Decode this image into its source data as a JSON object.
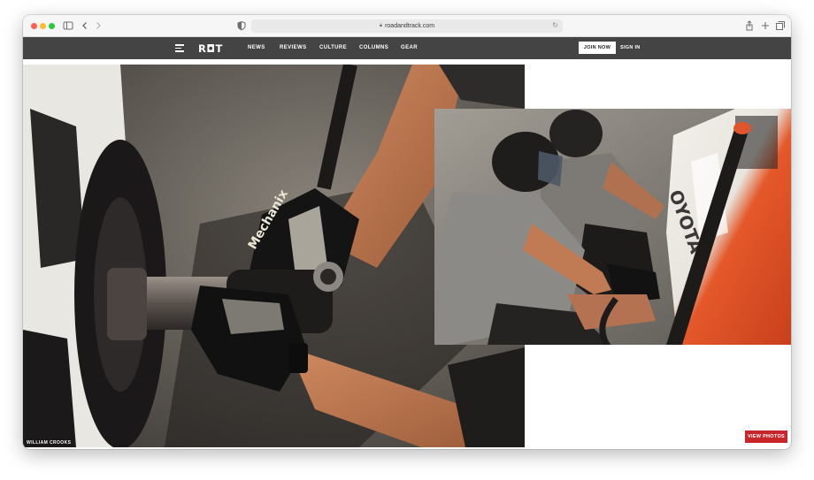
{
  "browser": {
    "url": "roadandtrack.com",
    "icons": [
      "sidebar-icon",
      "back-icon",
      "forward-icon",
      "privacy-icon",
      "lock-icon",
      "reload-icon",
      "share-icon",
      "new-tab-icon",
      "tabs-icon"
    ]
  },
  "site": {
    "logo_text": "R◘T",
    "nav": [
      "NEWS",
      "REVIEWS",
      "CULTURE",
      "COLUMNS",
      "GEAR"
    ],
    "join_label": "JOIN NOW",
    "signin_label": "SIGN IN"
  },
  "hero": {
    "photo_credit": "WILLIAM CROOKS",
    "view_photos_label": "VIEW PHOTOS",
    "glove_text": "Mechanix"
  },
  "colors": {
    "nav_bg": "#444444",
    "accent": "#c8262b"
  }
}
